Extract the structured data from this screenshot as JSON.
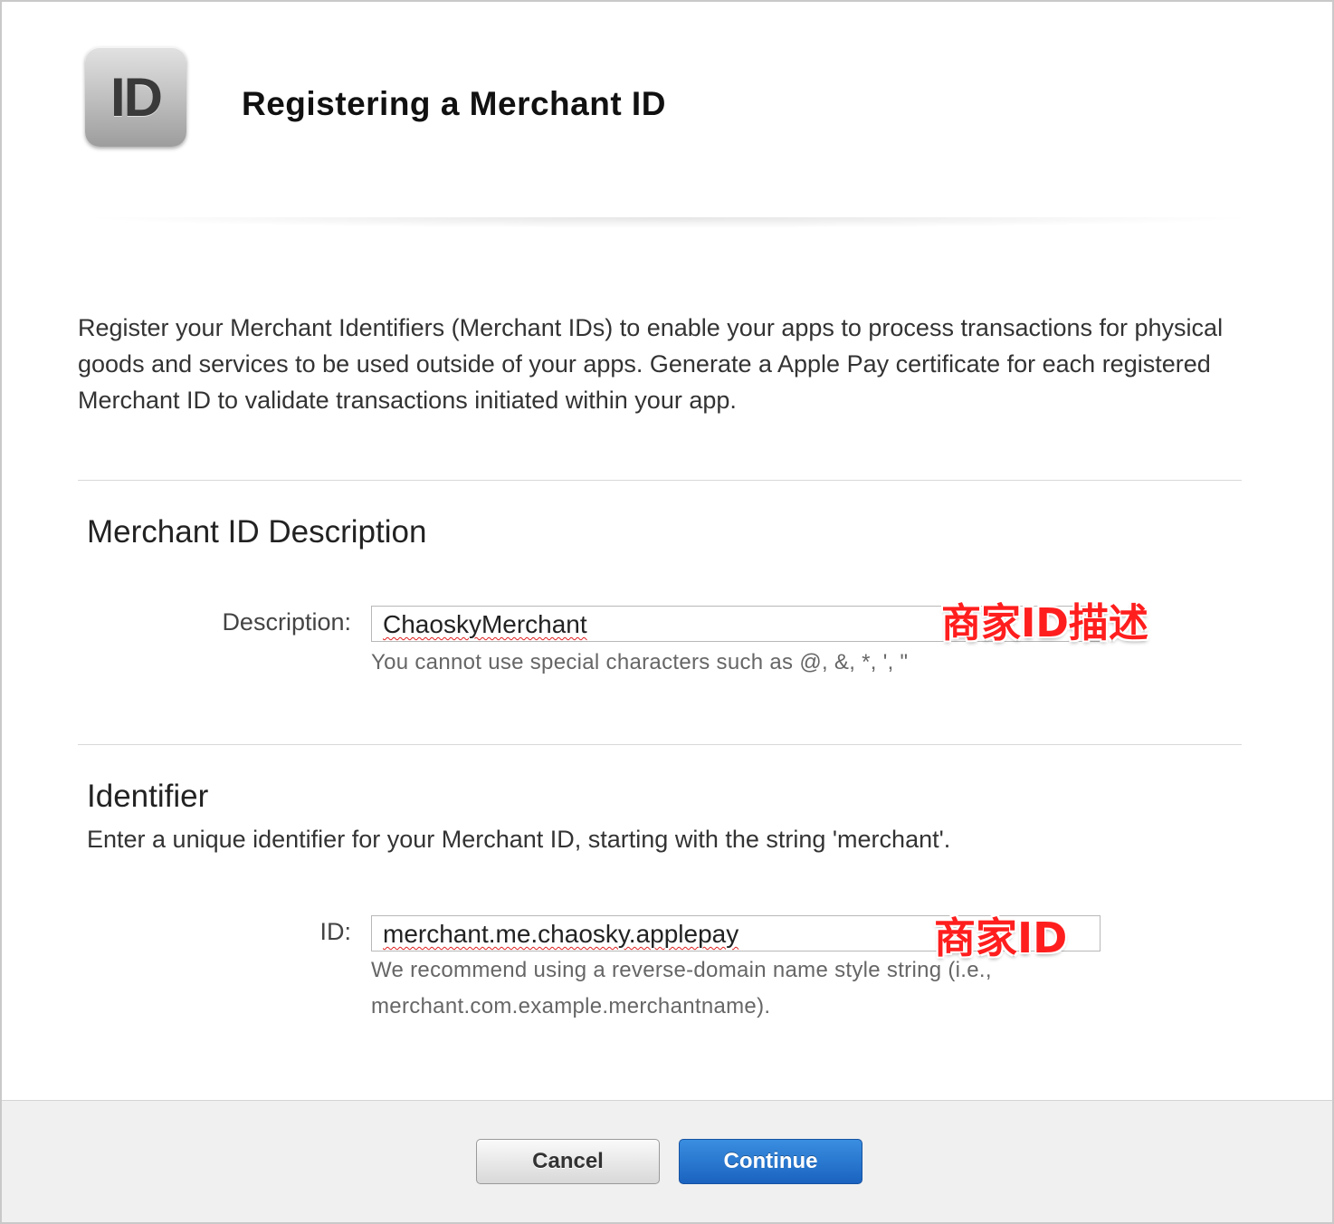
{
  "header": {
    "icon_text": "ID",
    "title": "Registering a Merchant ID"
  },
  "intro_text": "Register your Merchant Identifiers (Merchant IDs) to enable your apps to process transactions for physical goods and services to be used outside of your apps. Generate a Apple Pay certificate for each registered Merchant ID to validate transactions initiated within your app.",
  "description_section": {
    "title": "Merchant ID Description",
    "field_label": "Description:",
    "field_value": "ChaoskyMerchant",
    "hint": "You cannot use special characters such as @, &, *, ', \"",
    "annotation": "商家ID描述"
  },
  "identifier_section": {
    "title": "Identifier",
    "subtitle": "Enter a unique identifier for your Merchant ID, starting with the string 'merchant'.",
    "field_label": "ID:",
    "field_value": "merchant.me.chaosky.applepay",
    "hint_line1": "We recommend using a reverse-domain name style string (i.e.,",
    "hint_line2": "merchant.com.example.merchantname).",
    "annotation": "商家ID"
  },
  "footer": {
    "cancel_label": "Cancel",
    "continue_label": "Continue"
  },
  "colors": {
    "annotation": "#ff1e1e",
    "primary_button": "#1a63c0"
  }
}
